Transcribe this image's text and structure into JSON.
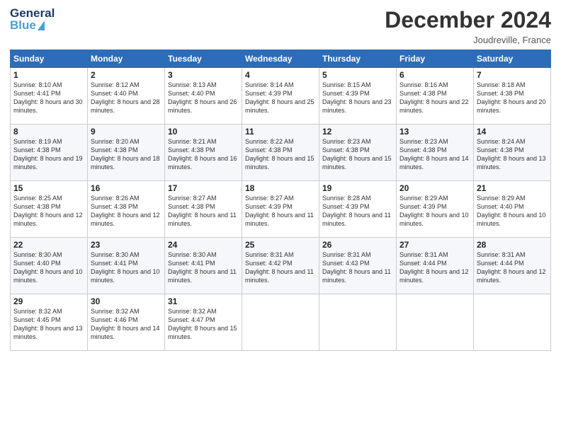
{
  "header": {
    "logo_line1": "General",
    "logo_line2": "Blue",
    "month_title": "December 2024",
    "location": "Joudreville, France"
  },
  "calendar": {
    "days_of_week": [
      "Sunday",
      "Monday",
      "Tuesday",
      "Wednesday",
      "Thursday",
      "Friday",
      "Saturday"
    ],
    "weeks": [
      [
        {
          "day": "1",
          "sunrise": "8:10 AM",
          "sunset": "4:41 PM",
          "daylight": "8 hours and 30 minutes."
        },
        {
          "day": "2",
          "sunrise": "8:12 AM",
          "sunset": "4:40 PM",
          "daylight": "8 hours and 28 minutes."
        },
        {
          "day": "3",
          "sunrise": "8:13 AM",
          "sunset": "4:40 PM",
          "daylight": "8 hours and 26 minutes."
        },
        {
          "day": "4",
          "sunrise": "8:14 AM",
          "sunset": "4:39 PM",
          "daylight": "8 hours and 25 minutes."
        },
        {
          "day": "5",
          "sunrise": "8:15 AM",
          "sunset": "4:39 PM",
          "daylight": "8 hours and 23 minutes."
        },
        {
          "day": "6",
          "sunrise": "8:16 AM",
          "sunset": "4:38 PM",
          "daylight": "8 hours and 22 minutes."
        },
        {
          "day": "7",
          "sunrise": "8:18 AM",
          "sunset": "4:38 PM",
          "daylight": "8 hours and 20 minutes."
        }
      ],
      [
        {
          "day": "8",
          "sunrise": "8:19 AM",
          "sunset": "4:38 PM",
          "daylight": "8 hours and 19 minutes."
        },
        {
          "day": "9",
          "sunrise": "8:20 AM",
          "sunset": "4:38 PM",
          "daylight": "8 hours and 18 minutes."
        },
        {
          "day": "10",
          "sunrise": "8:21 AM",
          "sunset": "4:38 PM",
          "daylight": "8 hours and 16 minutes."
        },
        {
          "day": "11",
          "sunrise": "8:22 AM",
          "sunset": "4:38 PM",
          "daylight": "8 hours and 15 minutes."
        },
        {
          "day": "12",
          "sunrise": "8:23 AM",
          "sunset": "4:38 PM",
          "daylight": "8 hours and 15 minutes."
        },
        {
          "day": "13",
          "sunrise": "8:23 AM",
          "sunset": "4:38 PM",
          "daylight": "8 hours and 14 minutes."
        },
        {
          "day": "14",
          "sunrise": "8:24 AM",
          "sunset": "4:38 PM",
          "daylight": "8 hours and 13 minutes."
        }
      ],
      [
        {
          "day": "15",
          "sunrise": "8:25 AM",
          "sunset": "4:38 PM",
          "daylight": "8 hours and 12 minutes."
        },
        {
          "day": "16",
          "sunrise": "8:26 AM",
          "sunset": "4:38 PM",
          "daylight": "8 hours and 12 minutes."
        },
        {
          "day": "17",
          "sunrise": "8:27 AM",
          "sunset": "4:38 PM",
          "daylight": "8 hours and 11 minutes."
        },
        {
          "day": "18",
          "sunrise": "8:27 AM",
          "sunset": "4:39 PM",
          "daylight": "8 hours and 11 minutes."
        },
        {
          "day": "19",
          "sunrise": "8:28 AM",
          "sunset": "4:39 PM",
          "daylight": "8 hours and 11 minutes."
        },
        {
          "day": "20",
          "sunrise": "8:29 AM",
          "sunset": "4:39 PM",
          "daylight": "8 hours and 10 minutes."
        },
        {
          "day": "21",
          "sunrise": "8:29 AM",
          "sunset": "4:40 PM",
          "daylight": "8 hours and 10 minutes."
        }
      ],
      [
        {
          "day": "22",
          "sunrise": "8:30 AM",
          "sunset": "4:40 PM",
          "daylight": "8 hours and 10 minutes."
        },
        {
          "day": "23",
          "sunrise": "8:30 AM",
          "sunset": "4:41 PM",
          "daylight": "8 hours and 10 minutes."
        },
        {
          "day": "24",
          "sunrise": "8:30 AM",
          "sunset": "4:41 PM",
          "daylight": "8 hours and 11 minutes."
        },
        {
          "day": "25",
          "sunrise": "8:31 AM",
          "sunset": "4:42 PM",
          "daylight": "8 hours and 11 minutes."
        },
        {
          "day": "26",
          "sunrise": "8:31 AM",
          "sunset": "4:43 PM",
          "daylight": "8 hours and 11 minutes."
        },
        {
          "day": "27",
          "sunrise": "8:31 AM",
          "sunset": "4:44 PM",
          "daylight": "8 hours and 12 minutes."
        },
        {
          "day": "28",
          "sunrise": "8:31 AM",
          "sunset": "4:44 PM",
          "daylight": "8 hours and 12 minutes."
        }
      ],
      [
        {
          "day": "29",
          "sunrise": "8:32 AM",
          "sunset": "4:45 PM",
          "daylight": "8 hours and 13 minutes."
        },
        {
          "day": "30",
          "sunrise": "8:32 AM",
          "sunset": "4:46 PM",
          "daylight": "8 hours and 14 minutes."
        },
        {
          "day": "31",
          "sunrise": "8:32 AM",
          "sunset": "4:47 PM",
          "daylight": "8 hours and 15 minutes."
        },
        null,
        null,
        null,
        null
      ]
    ]
  }
}
